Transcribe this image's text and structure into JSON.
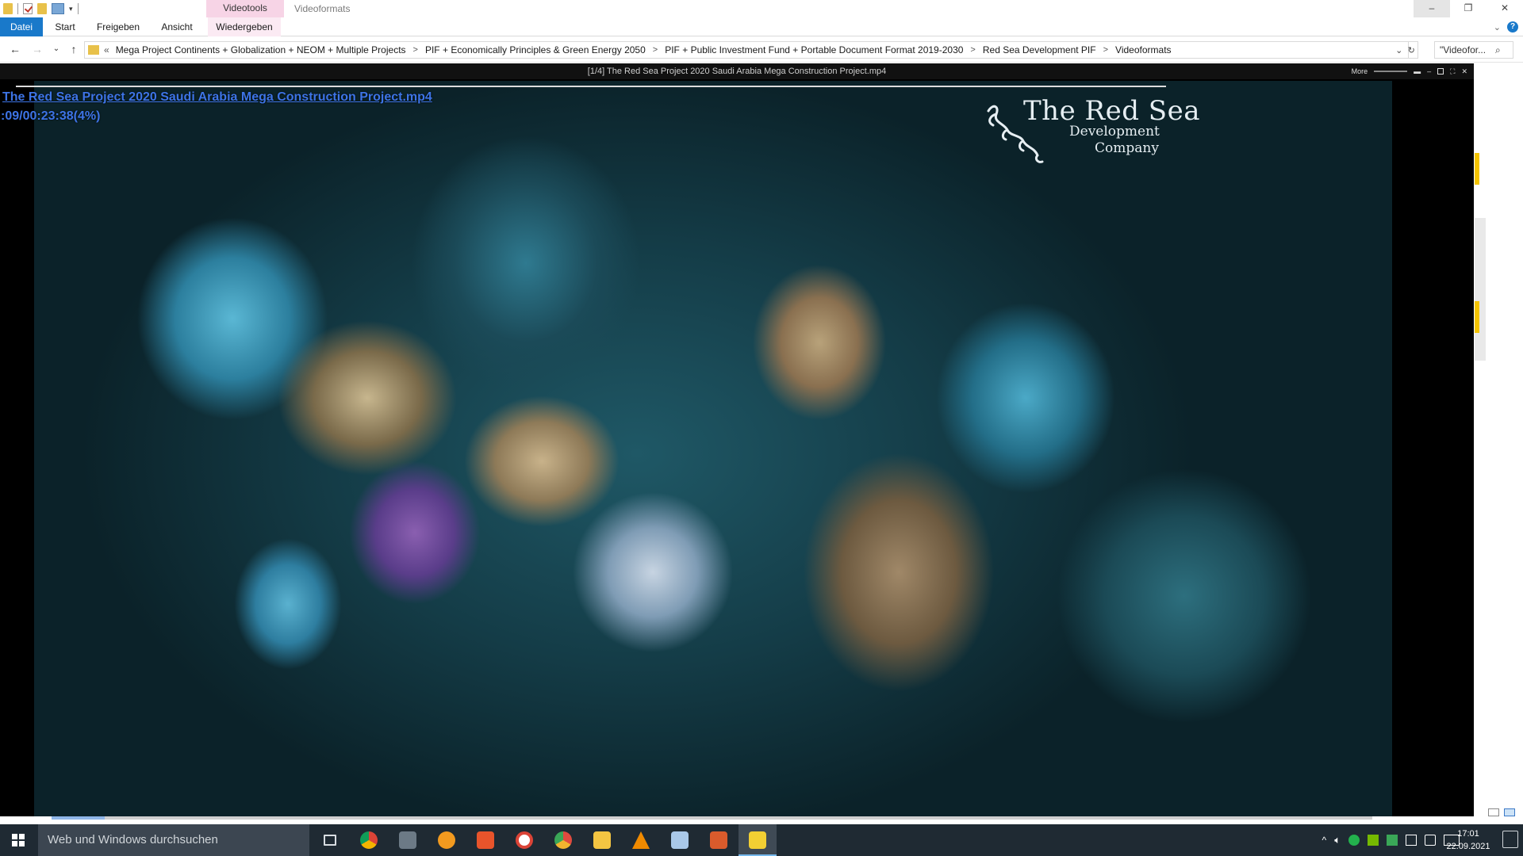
{
  "ribbon": {
    "context_tab": "Videotools",
    "context_title": "Videoformats",
    "tabs": [
      "Datei",
      "Start",
      "Freigeben",
      "Ansicht",
      "Wiedergeben"
    ]
  },
  "window_controls": {
    "minimize": "–",
    "restore": "❐",
    "close": "✕"
  },
  "address": {
    "prefix": "«",
    "crumbs": [
      "Mega Project Continents + Globalization + NEOM + Multiple Projects",
      "PIF + Economically Principles & Green Energy 2050",
      "PIF + Public Investment Fund + Portable Document Format 2019-2030",
      "Red Sea Development PIF",
      "Videoformats"
    ],
    "separator": ">"
  },
  "search": {
    "value": "\"Videofor..."
  },
  "player": {
    "title": "[1/4] The Red Sea Project 2020 Saudi Arabia Mega Construction Project.mp4",
    "more_label": "More",
    "osd_filename": "The Red Sea Project 2020 Saudi Arabia Mega Construction Project.mp4",
    "osd_time": ":09/00:23:38(4%)",
    "progress_fraction": 0.04
  },
  "video_logo": {
    "line1": "The Red Sea",
    "line2": "Development",
    "line3": "Company"
  },
  "taskbar": {
    "search_placeholder": "Web und Windows durchsuchen",
    "apps": [
      "task-view",
      "chrome",
      "photos",
      "app-orange",
      "app-red",
      "chrome-2",
      "chrome-canary",
      "file-explorer",
      "vlc",
      "image-viewer",
      "app-briefcase",
      "active-explorer"
    ],
    "time": "17:01",
    "date": "22.09.2021"
  },
  "colors": {
    "accent": "#1979ca",
    "context_tab": "#f7d4e6",
    "osd_text": "#3d74e6",
    "taskbar": "#1f2a33"
  }
}
